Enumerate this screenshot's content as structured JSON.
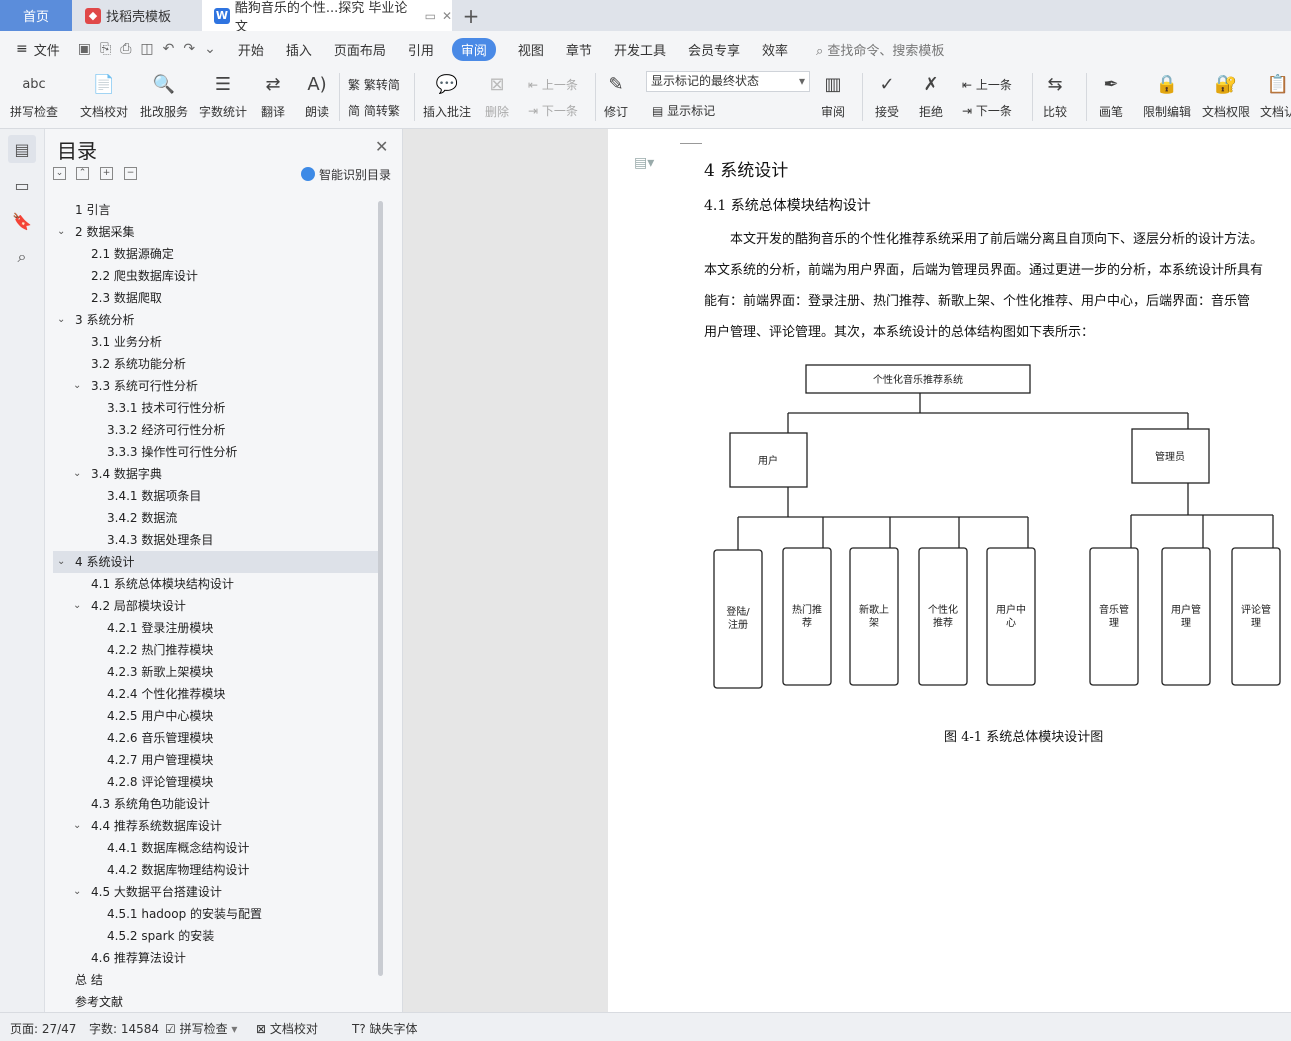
{
  "tabs": {
    "home": "首页",
    "templates": "找稻壳模板",
    "document": "酷狗音乐的个性...探究 毕业论文",
    "add": "+"
  },
  "menu": {
    "file": "文件",
    "items": [
      "开始",
      "插入",
      "页面布局",
      "引用",
      "审阅",
      "视图",
      "章节",
      "开发工具",
      "会员专享",
      "效率"
    ],
    "active": "审阅",
    "search_hint": "查找命令、搜索模板"
  },
  "ribbon": {
    "spellcheck": "拼写检查",
    "proofread": "文档校对",
    "approval": "批改服务",
    "wordcount": "字数统计",
    "translate": "翻译",
    "read_aloud": "朗读",
    "to_traditional": "繁转简",
    "to_simplified": "简转繁",
    "insert_comment": "插入批注",
    "delete": "删除",
    "prev": "上一条",
    "next": "下一条",
    "revise": "修订",
    "markup_state": "显示标记的最终状态",
    "show_markup": "显示标记",
    "review": "审阅",
    "accept": "接受",
    "reject": "拒绝",
    "prev2": "上一条",
    "next2": "下一条",
    "compare": "比较",
    "ink": "画笔",
    "restrict": "限制编辑",
    "permission": "文档权限",
    "cert": "文档认"
  },
  "toc": {
    "title": "目录",
    "smart": "智能识别目录",
    "items": [
      {
        "text": "1 引言",
        "level": 0,
        "arrow": ""
      },
      {
        "text": "2 数据采集",
        "level": 0,
        "arrow": "v"
      },
      {
        "text": "2.1 数据源确定",
        "level": 1,
        "arrow": ""
      },
      {
        "text": "2.2 爬虫数据库设计",
        "level": 1,
        "arrow": ""
      },
      {
        "text": "2.3 数据爬取",
        "level": 1,
        "arrow": ""
      },
      {
        "text": "3 系统分析",
        "level": 0,
        "arrow": "v"
      },
      {
        "text": "3.1 业务分析",
        "level": 1,
        "arrow": ""
      },
      {
        "text": "3.2 系统功能分析",
        "level": 1,
        "arrow": ""
      },
      {
        "text": "3.3  系统可行性分析",
        "level": 1,
        "arrow": "v"
      },
      {
        "text": "3.3.1  技术可行性分析",
        "level": 2,
        "arrow": ""
      },
      {
        "text": "3.3.2  经济可行性分析",
        "level": 2,
        "arrow": ""
      },
      {
        "text": "3.3.3  操作性可行性分析",
        "level": 2,
        "arrow": ""
      },
      {
        "text": "3.4  数据字典",
        "level": 1,
        "arrow": "v"
      },
      {
        "text": "3.4.1  数据项条目",
        "level": 2,
        "arrow": ""
      },
      {
        "text": "3.4.2  数据流",
        "level": 2,
        "arrow": ""
      },
      {
        "text": "3.4.3  数据处理条目",
        "level": 2,
        "arrow": ""
      },
      {
        "text": "4  系统设计",
        "level": 0,
        "arrow": "v",
        "selected": true
      },
      {
        "text": "4.1 系统总体模块结构设计",
        "level": 1,
        "arrow": ""
      },
      {
        "text": "4.2  局部模块设计",
        "level": 1,
        "arrow": "v"
      },
      {
        "text": "4.2.1  登录注册模块",
        "level": 2,
        "arrow": ""
      },
      {
        "text": "4.2.2  热门推荐模块",
        "level": 2,
        "arrow": ""
      },
      {
        "text": "4.2.3  新歌上架模块",
        "level": 2,
        "arrow": ""
      },
      {
        "text": "4.2.4  个性化推荐模块",
        "level": 2,
        "arrow": ""
      },
      {
        "text": "4.2.5  用户中心模块",
        "level": 2,
        "arrow": ""
      },
      {
        "text": "4.2.6  音乐管理模块",
        "level": 2,
        "arrow": ""
      },
      {
        "text": "4.2.7  用户管理模块",
        "level": 2,
        "arrow": ""
      },
      {
        "text": "4.2.8  评论管理模块",
        "level": 2,
        "arrow": ""
      },
      {
        "text": "4.3  系统角色功能设计",
        "level": 1,
        "arrow": ""
      },
      {
        "text": "4.4  推荐系统数据库设计",
        "level": 1,
        "arrow": "v"
      },
      {
        "text": "4.4.1  数据库概念结构设计",
        "level": 2,
        "arrow": ""
      },
      {
        "text": "4.4.2  数据库物理结构设计",
        "level": 2,
        "arrow": ""
      },
      {
        "text": "4.5  大数据平台搭建设计",
        "level": 1,
        "arrow": "v"
      },
      {
        "text": "4.5.1 hadoop 的安装与配置",
        "level": 2,
        "arrow": ""
      },
      {
        "text": "4.5.2 spark 的安装",
        "level": 2,
        "arrow": ""
      },
      {
        "text": "4.6  推荐算法设计",
        "level": 1,
        "arrow": ""
      },
      {
        "text": "总    结",
        "level": 0,
        "arrow": ""
      },
      {
        "text": "参考文献",
        "level": 0,
        "arrow": ""
      }
    ]
  },
  "doc": {
    "h1": "4  系统设计",
    "h2": "4.1 系统总体模块结构设计",
    "lines": [
      "本文开发的酷狗音乐的个性化推荐系统采用了前后端分离且自顶向下、逐层分析的设计方法。",
      "本文系统的分析，前端为用户界面，后端为管理员界面。通过更进一步的分析，本系统设计所具有",
      "能有：前端界面：登录注册、热门推荐、新歌上架、个性化推荐、用户中心，后端界面：音乐管",
      "用户管理、评论管理。其次，本系统设计的总体结构图如下表所示："
    ],
    "diagram": {
      "root": "个性化音乐推荐系统",
      "user": "用户",
      "admin": "管理员",
      "user_modules": [
        [
          "登陆/",
          "注册"
        ],
        [
          "热门推",
          "荐"
        ],
        [
          "新歌上",
          "架"
        ],
        [
          "个性化",
          "推荐"
        ],
        [
          "用户中",
          "心"
        ]
      ],
      "admin_modules": [
        [
          "音乐管",
          "理"
        ],
        [
          "用户管",
          "理"
        ],
        [
          "评论管",
          "理"
        ]
      ]
    },
    "caption": "图 4-1  系统总体模块设计图"
  },
  "status": {
    "page": "页面: 27/47",
    "words": "字数: 14584",
    "spell": "拼写检查",
    "proof": "文档校对",
    "font": "缺失字体"
  }
}
